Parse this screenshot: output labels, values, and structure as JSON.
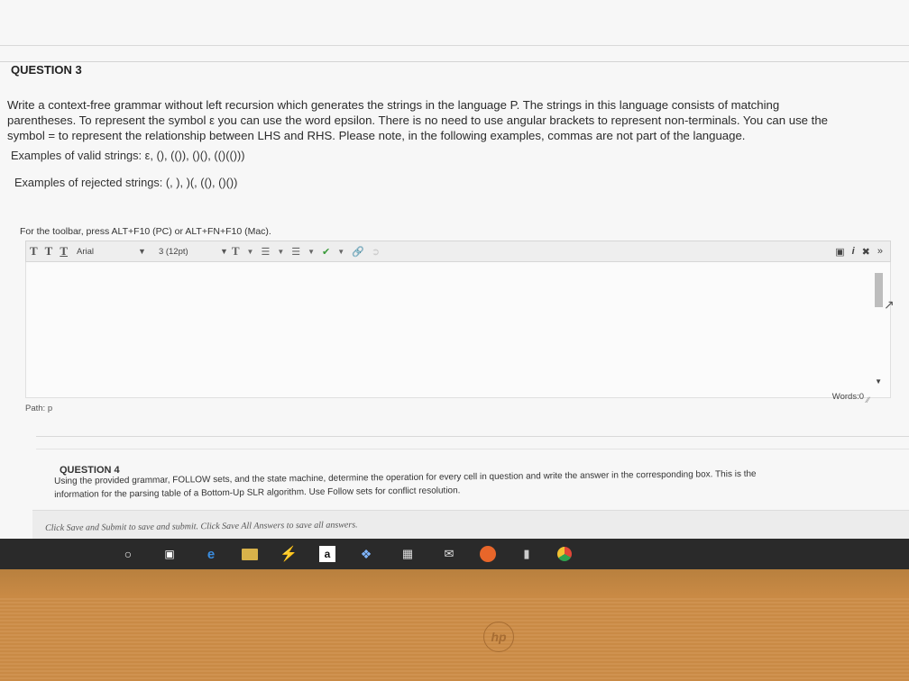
{
  "question3": {
    "title": "QUESTION 3",
    "text_lines": [
      "Write a context-free grammar without left recursion which generates the strings in the language P. The strings in this language consists of matching",
      "parentheses. To represent the symbol ε you can use the word epsilon. There is no need to use angular brackets to represent non-terminals. You can use the",
      "symbol = to represent the relationship between LHS and RHS. Please note, in the following examples, commas are not part of the language."
    ],
    "valid_examples": "Examples of valid strings: ε, (), (()), ()(), (()(()))",
    "rejected_examples": "Examples of rejected strings: (, ), )(, ((), ()())"
  },
  "editor": {
    "toolbar_hint": "For the toolbar, press ALT+F10 (PC) or ALT+FN+F10 (Mac).",
    "font_family": "Arial",
    "font_size": "3 (12pt)",
    "words": "Words:0",
    "path": "Path: p"
  },
  "question4": {
    "title": "QUESTION 4",
    "text_lines": [
      "Using the provided grammar, FOLLOW sets, and the state machine, determine the operation for every cell in question and write the answer in the corresponding box. This is the",
      "information for the parsing table of a Bottom-Up SLR algorithm. Use Follow sets for conflict resolution."
    ]
  },
  "submit_text": "Click Save and Submit to save and submit. Click Save All Answers to save all answers.",
  "taskbar": {
    "amazon_label": "a"
  },
  "brand": "hp"
}
